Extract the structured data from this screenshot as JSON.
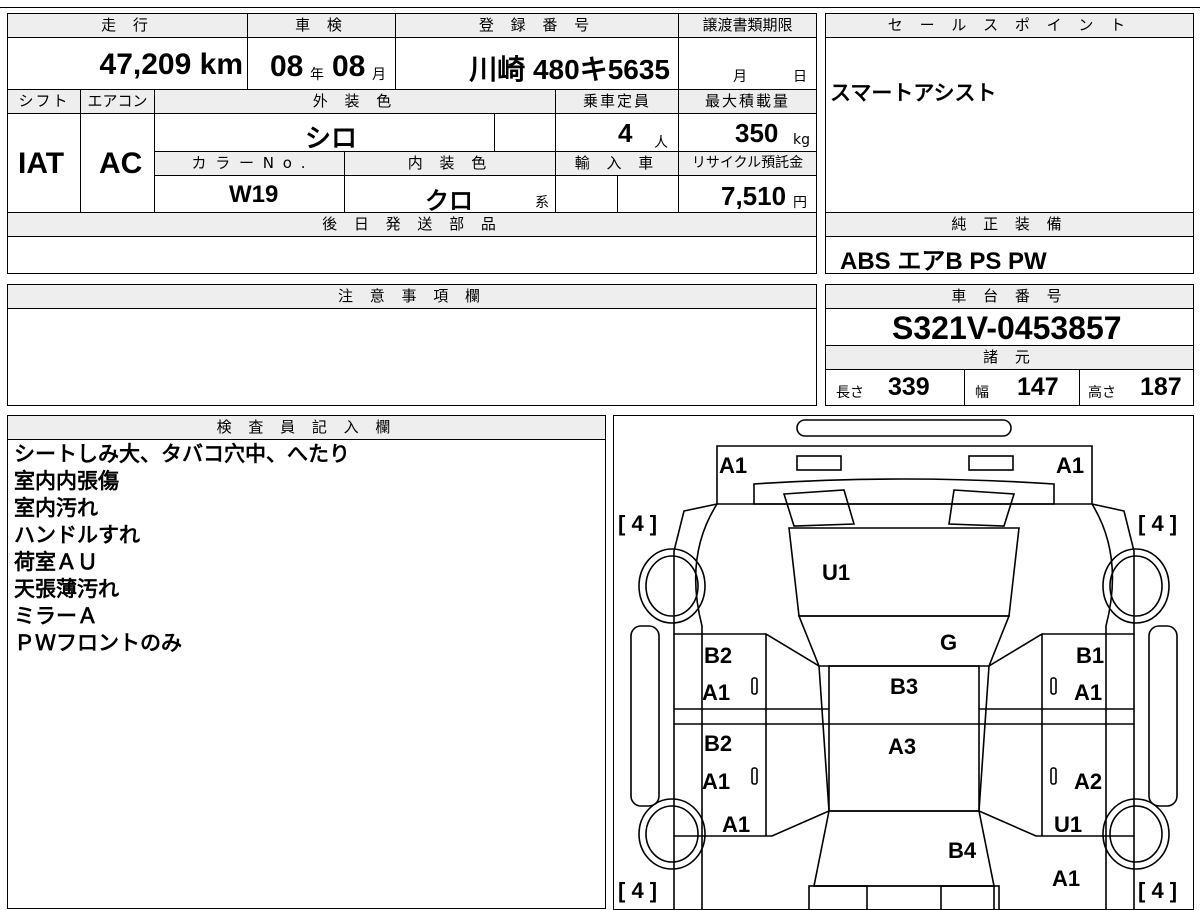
{
  "header_labels": {
    "mileage": "走 行",
    "inspection": "車 検",
    "registration": "登 録 番 号",
    "transfer_deadline": "譲渡書類期限",
    "shift": "シフト",
    "aircon": "エアコン",
    "exterior_color": "外 装 色",
    "capacity": "乗車定員",
    "max_load": "最大積載量",
    "color_no": "カ ラ ー N o .",
    "interior_color": "内 装 色",
    "import_car": "輸 入 車",
    "recycle_deposit": "リサイクル預託金",
    "later_parts": "後 日 発 送 部 品",
    "sales_point": "セ ー ル ス ポ イ ン ト",
    "genuine_equipment": "純 正 装 備",
    "caution": "注 意 事 項 欄",
    "chassis_number": "車 台 番 号",
    "specs": "諸 元",
    "inspector_notes": "検 査 員 記 入 欄"
  },
  "values": {
    "mileage": "47,209 km",
    "inspection_year": "08",
    "inspection_year_unit": "年",
    "inspection_month": "08",
    "inspection_month_unit": "月",
    "registration": "川崎 480キ5635",
    "transfer_month_unit": "月",
    "transfer_day_unit": "日",
    "shift": "IAT",
    "aircon": "AC",
    "exterior_color": "シロ",
    "capacity": "4",
    "capacity_unit": "人",
    "max_load": "350",
    "max_load_unit": "kg",
    "color_no": "W19",
    "interior_color": "クロ",
    "interior_color_suffix": "系",
    "recycle_deposit": "7,510",
    "recycle_unit": "円",
    "sales_point": "スマートアシスト",
    "genuine_equipment": "ABS エアB PS PW",
    "chassis_number": "S321V-0453857",
    "length_label": "長さ",
    "length": "339",
    "width_label": "幅",
    "width": "147",
    "height_label": "高さ",
    "height": "187"
  },
  "inspector_notes": [
    "シートしみ大、タバコ穴中、へたり",
    "室内内張傷",
    "室内汚れ",
    "ハンドルすれ",
    "荷室ＡＵ",
    "天張薄汚れ",
    "ミラーＡ",
    "ＰＷフロントのみ"
  ],
  "diagram": {
    "tires": [
      "[ 4 ]",
      "[ 4 ]",
      "[ 4 ]",
      "[ 4 ]"
    ],
    "marks": {
      "front_left": "A1",
      "front_right": "A1",
      "hood": "U1",
      "windshield": "G",
      "front_left_door_b": "B2",
      "front_left_door_a": "A1",
      "front_right_door_b": "B1",
      "front_right_door_a": "A1",
      "roof_front": "B3",
      "roof_rear": "A3",
      "rear_left_door_b": "B2",
      "rear_left_door_a": "A1",
      "rear_right_door_a": "A2",
      "rear_left_quarter": "A1",
      "rear_right_quarter": "U1",
      "back_door": "B4",
      "rear_right_bumper": "A1"
    }
  }
}
